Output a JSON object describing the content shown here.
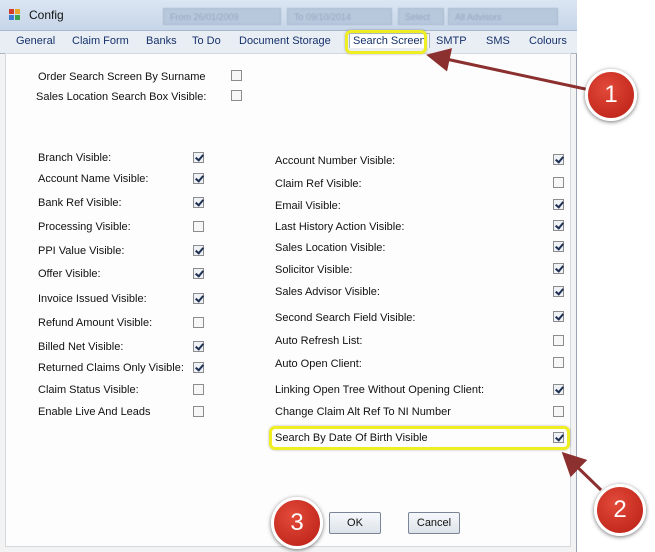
{
  "window": {
    "title": "Config",
    "ghost_fields": [
      "From 26/01/2009",
      "To 09/10/2014",
      "Select",
      "All Advisors"
    ]
  },
  "tabs": [
    "General",
    "Claim Form",
    "Banks",
    "To Do",
    "Document Storage",
    "Search Screen",
    "SMTP",
    "SMS",
    "Colours"
  ],
  "active_tab": "Search Screen",
  "top_options": [
    {
      "label": "Order Search Screen By Surname",
      "checked": false
    },
    {
      "label": "Sales Location Search Box Visible:",
      "checked": false
    }
  ],
  "left_column": [
    {
      "label": "Branch Visible:",
      "checked": true
    },
    {
      "label": "Account Name Visible:",
      "checked": true
    },
    {
      "label": "Bank Ref Visible:",
      "checked": true
    },
    {
      "label": "Processing Visible:",
      "checked": false
    },
    {
      "label": "PPI Value Visible:",
      "checked": true
    },
    {
      "label": "Offer Visible:",
      "checked": true
    },
    {
      "label": "Invoice Issued Visible:",
      "checked": true
    },
    {
      "label": "Refund Amount Visible:",
      "checked": false
    },
    {
      "label": "Billed Net Visible:",
      "checked": true
    },
    {
      "label": "Returned Claims Only Visible:",
      "checked": true
    },
    {
      "label": "Claim Status Visible:",
      "checked": false
    },
    {
      "label": "Enable Live And Leads",
      "checked": false
    }
  ],
  "right_column": [
    {
      "label": "Account Number Visible:",
      "checked": true
    },
    {
      "label": "Claim Ref Visible:",
      "checked": false
    },
    {
      "label": "Email Visible:",
      "checked": true
    },
    {
      "label": "Last History Action Visible:",
      "checked": true
    },
    {
      "label": "Sales Location Visible:",
      "checked": true
    },
    {
      "label": "Solicitor Visible:",
      "checked": true
    },
    {
      "label": "Sales Advisor Visible:",
      "checked": true
    },
    {
      "label": "Second Search Field Visible:",
      "checked": true
    },
    {
      "label": "Auto Refresh List:",
      "checked": false
    },
    {
      "label": "Auto Open Client:",
      "checked": false
    },
    {
      "label": "Linking Open Tree Without Opening Client:",
      "checked": true
    },
    {
      "label": "Change Claim Alt Ref To NI Number",
      "checked": false
    },
    {
      "label": "Search By Date Of Birth Visible",
      "checked": true
    }
  ],
  "buttons": {
    "ok": "OK",
    "cancel": "Cancel"
  },
  "callouts": [
    "1",
    "2",
    "3"
  ],
  "colors": {
    "highlight": "#eeee22",
    "badge": "#c8281c",
    "arrow": "#8b2f2f"
  }
}
